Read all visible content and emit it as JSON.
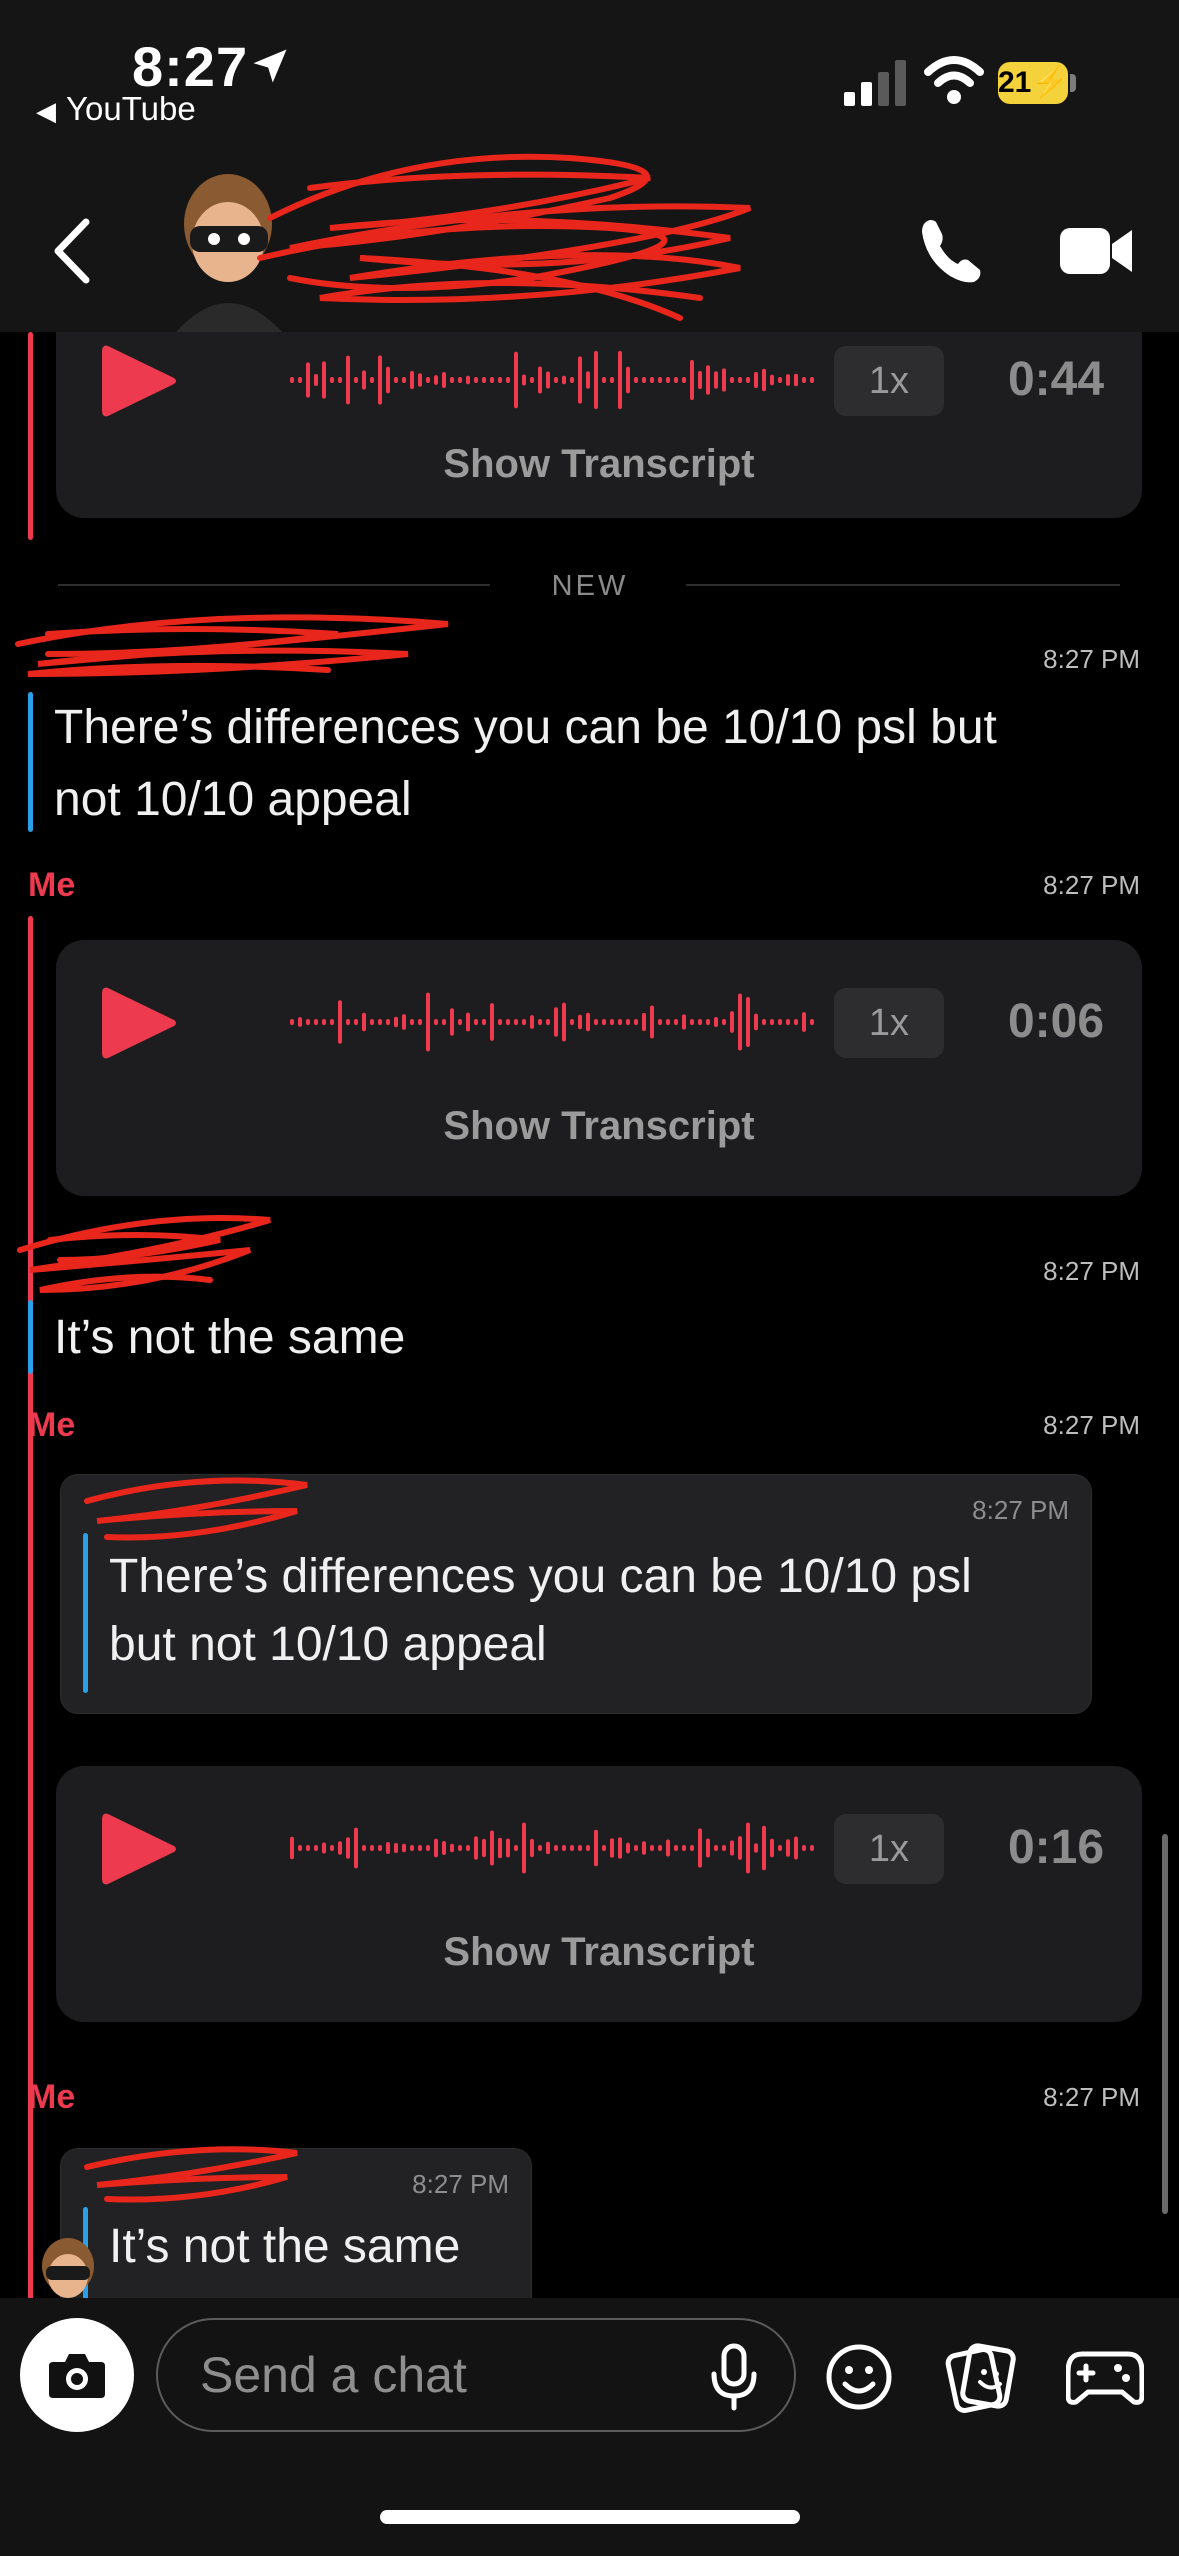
{
  "status_bar": {
    "time": "8:27",
    "back_app": "YouTube",
    "battery": "21"
  },
  "header": {
    "contact_name": ""
  },
  "messages": {
    "voice_top": {
      "speed": "1x",
      "duration": "0:44",
      "transcript": "Show Transcript"
    },
    "new_divider": "NEW",
    "msg1": {
      "time": "8:27 PM",
      "text_line1": "There’s differences you can be 10/10 psl but",
      "text_line2": "not 10/10 appeal"
    },
    "me_block1": {
      "sender": "Me",
      "time": "8:27 PM",
      "speed": "1x",
      "duration": "0:06",
      "transcript": "Show Transcript"
    },
    "msg2": {
      "time": "8:27 PM",
      "text": "It’s not the same"
    },
    "me_block2": {
      "sender": "Me",
      "time": "8:27 PM",
      "quote_time": "8:27 PM",
      "quote_line1": "There’s differences you can be 10/10 psl",
      "quote_line2": "but not 10/10 appeal",
      "speed": "1x",
      "duration": "0:16",
      "transcript": "Show Transcript"
    },
    "me_block3": {
      "sender": "Me",
      "time": "8:27 PM",
      "quote_time": "8:27 PM",
      "quote_text": "It’s not the same"
    }
  },
  "input": {
    "placeholder": "Send a chat"
  },
  "colors": {
    "accent_red": "#ee3a4f",
    "accent_blue": "#2aa0e8",
    "background": "#000000",
    "card": "#1d1d1f"
  }
}
